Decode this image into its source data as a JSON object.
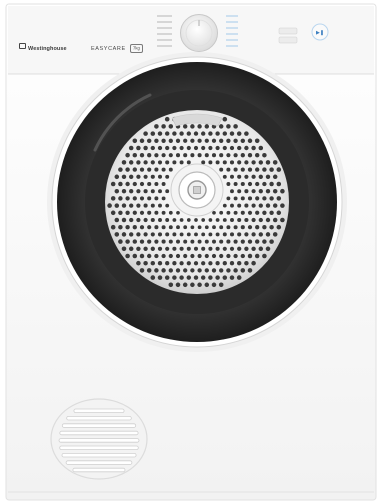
{
  "brand": {
    "logo_text": "Westinghouse"
  },
  "model": {
    "name": "EASYCARE",
    "badge": "7kg"
  },
  "colors": {
    "body": "#ffffff",
    "control_panel": "#f6f6f6",
    "door_ring": "#262626",
    "drum": "#e6e6e6",
    "program_accent": "#4a9ad6"
  }
}
